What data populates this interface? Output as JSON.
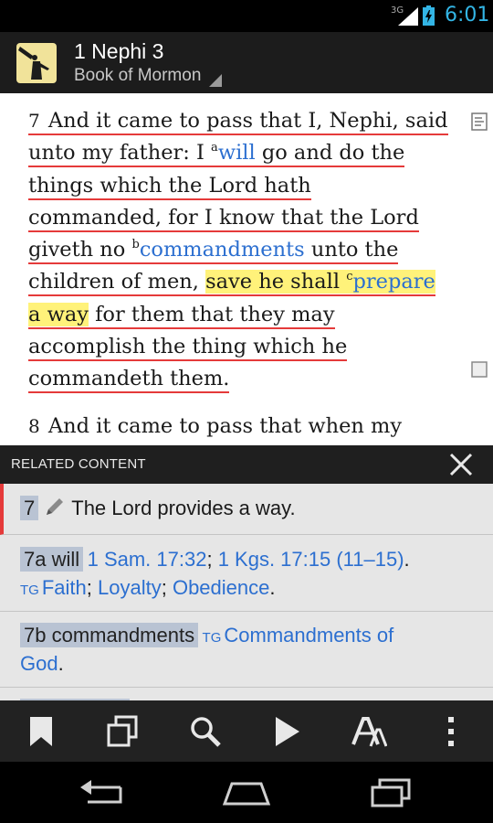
{
  "status": {
    "network": "3G",
    "time": "6:01"
  },
  "appbar": {
    "title": "1 Nephi 3",
    "subtitle": "Book of Mormon"
  },
  "verses": {
    "v7": {
      "number": "7",
      "p1": "And it came to pass that I, Nephi, said",
      "p2": "unto my father: I ",
      "sup_a": "a",
      "ref_a": "will",
      "p3": " go and do the",
      "p4": "things which the Lord hath",
      "p5": "commanded, for I know that the Lord",
      "p6": "giveth no ",
      "sup_b": "b",
      "ref_b": "commandments",
      "p7": " unto the",
      "p8": "children of men, ",
      "hl1": "save he shall ",
      "sup_c": "c",
      "ref_c": "prepare",
      "hl2": "a way",
      "p9": " for them that they may",
      "p10": "accomplish the thing which he",
      "p11": "commandeth them."
    },
    "v8": {
      "number": "8",
      "text": "And it came to pass that when my"
    }
  },
  "related": {
    "header": "RELATED CONTENT",
    "items": [
      {
        "tag": "7",
        "text": "The Lord provides a way."
      },
      {
        "tag": "7a will",
        "links": [
          "1 Sam. 17:32",
          "1 Kgs. 17:15 (11–15)"
        ],
        "tg": "TG",
        "topics": [
          "Faith",
          "Loyalty",
          "Obedience"
        ]
      },
      {
        "tag": "7b commandments",
        "tg": "TG",
        "topic1": "Commandments of",
        "topic2": "God"
      }
    ]
  },
  "toolbar_icons": [
    "bookmark-icon",
    "copy-icon",
    "search-icon",
    "play-icon",
    "font-size-icon",
    "overflow-menu-icon"
  ],
  "navbar_icons": [
    "back-icon",
    "home-icon",
    "recents-icon"
  ],
  "colors": {
    "accent": "#2c6fd0",
    "underline": "#e53a3a",
    "highlight": "#fff27a",
    "status_blue": "#33b5e5"
  }
}
